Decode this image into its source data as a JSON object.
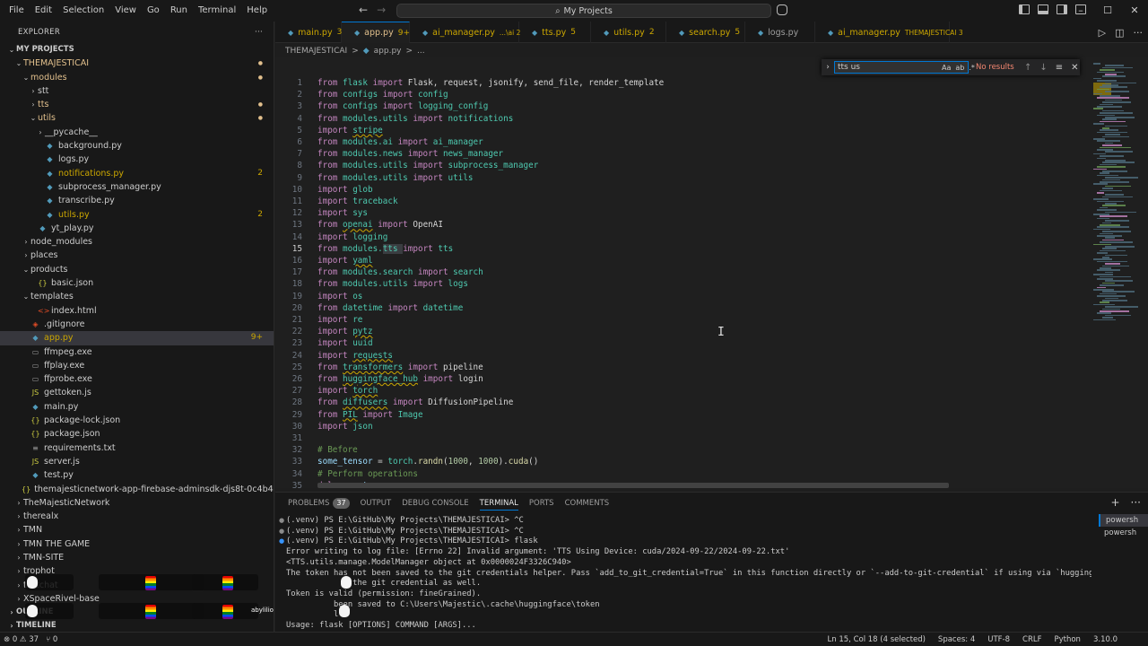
{
  "menu": [
    "File",
    "Edit",
    "Selection",
    "View",
    "Go",
    "Run",
    "Terminal",
    "Help"
  ],
  "command_center": {
    "label": "My Projects"
  },
  "window_controls": {
    "minimize": "–",
    "maximize": "☐",
    "close": "✕"
  },
  "explorer": {
    "title": "EXPLORER",
    "more": "···",
    "root": "MY PROJECTS",
    "rows": [
      {
        "label": "THEMAJESTICAI",
        "indent": 1,
        "kind": "folder-open",
        "color": "mod",
        "badge": "●"
      },
      {
        "label": "modules",
        "indent": 2,
        "kind": "folder-open",
        "color": "mod",
        "badge": "●"
      },
      {
        "label": "stt",
        "indent": 3,
        "kind": "folder",
        "color": "def",
        "badge": ""
      },
      {
        "label": "tts",
        "indent": 3,
        "kind": "folder",
        "color": "mod",
        "badge": "●"
      },
      {
        "label": "utils",
        "indent": 3,
        "kind": "folder-open",
        "color": "mod",
        "badge": "●"
      },
      {
        "label": "__pycache__",
        "indent": 4,
        "kind": "folder",
        "color": "def",
        "badge": ""
      },
      {
        "label": "background.py",
        "indent": 4,
        "kind": "py",
        "color": "def",
        "badge": ""
      },
      {
        "label": "logs.py",
        "indent": 4,
        "kind": "py",
        "color": "def",
        "badge": ""
      },
      {
        "label": "notifications.py",
        "indent": 4,
        "kind": "py",
        "color": "err",
        "badge": "2"
      },
      {
        "label": "subprocess_manager.py",
        "indent": 4,
        "kind": "py",
        "color": "def",
        "badge": ""
      },
      {
        "label": "transcribe.py",
        "indent": 4,
        "kind": "py",
        "color": "def",
        "badge": ""
      },
      {
        "label": "utils.py",
        "indent": 4,
        "kind": "py",
        "color": "err",
        "badge": "2"
      },
      {
        "label": "yt_play.py",
        "indent": 3,
        "kind": "py",
        "color": "def",
        "badge": ""
      },
      {
        "label": "node_modules",
        "indent": 2,
        "kind": "folder",
        "color": "def",
        "badge": ""
      },
      {
        "label": "places",
        "indent": 2,
        "kind": "folder",
        "color": "def",
        "badge": ""
      },
      {
        "label": "products",
        "indent": 2,
        "kind": "folder-open",
        "color": "def",
        "badge": ""
      },
      {
        "label": "basic.json",
        "indent": 3,
        "kind": "json",
        "color": "def",
        "badge": ""
      },
      {
        "label": "templates",
        "indent": 2,
        "kind": "folder-open",
        "color": "def",
        "badge": ""
      },
      {
        "label": "index.html",
        "indent": 3,
        "kind": "html",
        "color": "def",
        "badge": ""
      },
      {
        "label": ".gitignore",
        "indent": 2,
        "kind": "git",
        "color": "def",
        "badge": ""
      },
      {
        "label": "app.py",
        "indent": 2,
        "kind": "py",
        "color": "err",
        "badge": "9+",
        "selected": true
      },
      {
        "label": "ffmpeg.exe",
        "indent": 2,
        "kind": "exe",
        "color": "def",
        "badge": ""
      },
      {
        "label": "ffplay.exe",
        "indent": 2,
        "kind": "exe",
        "color": "def",
        "badge": ""
      },
      {
        "label": "ffprobe.exe",
        "indent": 2,
        "kind": "exe",
        "color": "def",
        "badge": ""
      },
      {
        "label": "gettoken.js",
        "indent": 2,
        "kind": "js",
        "color": "def",
        "badge": ""
      },
      {
        "label": "main.py",
        "indent": 2,
        "kind": "py",
        "color": "def",
        "badge": ""
      },
      {
        "label": "package-lock.json",
        "indent": 2,
        "kind": "json",
        "color": "def",
        "badge": ""
      },
      {
        "label": "package.json",
        "indent": 2,
        "kind": "json",
        "color": "def",
        "badge": ""
      },
      {
        "label": "requirements.txt",
        "indent": 2,
        "kind": "txt",
        "color": "def",
        "badge": ""
      },
      {
        "label": "server.js",
        "indent": 2,
        "kind": "js",
        "color": "def",
        "badge": ""
      },
      {
        "label": "test.py",
        "indent": 2,
        "kind": "py",
        "color": "def",
        "badge": ""
      },
      {
        "label": "themajesticnetwork-app-firebase-adminsdk-djs8t-0c4b43e23d.json",
        "indent": 2,
        "kind": "json",
        "color": "def",
        "badge": ""
      },
      {
        "label": "TheMajesticNetwork",
        "indent": 1,
        "kind": "folder",
        "color": "def",
        "badge": ""
      },
      {
        "label": "therealx",
        "indent": 1,
        "kind": "folder",
        "color": "def",
        "badge": ""
      },
      {
        "label": "TMN",
        "indent": 1,
        "kind": "folder",
        "color": "def",
        "badge": ""
      },
      {
        "label": "TMN THE GAME",
        "indent": 1,
        "kind": "folder",
        "color": "def",
        "badge": ""
      },
      {
        "label": "TMN-SITE",
        "indent": 1,
        "kind": "folder",
        "color": "def",
        "badge": ""
      },
      {
        "label": "trophot",
        "indent": 1,
        "kind": "folder",
        "color": "def",
        "badge": ""
      },
      {
        "label": "twitchat",
        "indent": 1,
        "kind": "folder",
        "color": "def",
        "badge": ""
      },
      {
        "label": "XSpaceRivel-base",
        "indent": 1,
        "kind": "folder",
        "color": "def",
        "badge": ""
      },
      {
        "label": "OUTLINE",
        "indent": 0,
        "kind": "section",
        "color": "def",
        "badge": ""
      },
      {
        "label": "TIMELINE",
        "indent": 0,
        "kind": "section",
        "color": "def",
        "badge": ""
      }
    ]
  },
  "tabs": [
    {
      "name": "main.py",
      "badge": "3",
      "active": false,
      "width": 74
    },
    {
      "name": "app.py",
      "badge": "9+",
      "active": true,
      "width": 76
    },
    {
      "name": "ai_manager.py",
      "badge": "...\\ai 2",
      "active": false,
      "width": 122
    },
    {
      "name": "tts.py",
      "badge": "5",
      "active": false,
      "width": 80
    },
    {
      "name": "utils.py",
      "badge": "2",
      "active": false,
      "width": 84
    },
    {
      "name": "search.py",
      "badge": "5",
      "active": false,
      "width": 88
    },
    {
      "name": "logs.py",
      "badge": "",
      "active": false,
      "width": 78
    },
    {
      "name": "ai_manager.py",
      "badge": "THEMAJESTICAI 3",
      "active": false,
      "width": 150
    }
  ],
  "breadcrumb": {
    "folder": "THEMAJESTICAI",
    "sep": ">",
    "file": "app.py",
    "tail": "..."
  },
  "find": {
    "query": "tts us",
    "result": "No results",
    "opt_case": "Aa",
    "opt_word": "ab",
    "opt_regex": ".*"
  },
  "code": [
    [
      [
        "kw",
        "from "
      ],
      [
        "mod",
        "flask"
      ],
      [
        "kw",
        " import "
      ],
      [
        "pl",
        "Flask, request, jsonify, send_file, render_template"
      ]
    ],
    [
      [
        "kw",
        "from "
      ],
      [
        "mod",
        "configs"
      ],
      [
        "kw",
        " import "
      ],
      [
        "mod",
        "config"
      ]
    ],
    [
      [
        "kw",
        "from "
      ],
      [
        "mod",
        "configs"
      ],
      [
        "kw",
        " import "
      ],
      [
        "mod",
        "logging_config"
      ]
    ],
    [
      [
        "kw",
        "from "
      ],
      [
        "mod",
        "modules.utils"
      ],
      [
        "kw",
        " import "
      ],
      [
        "mod",
        "notifications"
      ]
    ],
    [
      [
        "kw",
        "import "
      ],
      [
        "mod sq",
        "stripe"
      ]
    ],
    [
      [
        "kw",
        "from "
      ],
      [
        "mod",
        "modules.ai"
      ],
      [
        "kw",
        " import "
      ],
      [
        "mod",
        "ai_manager"
      ]
    ],
    [
      [
        "kw",
        "from "
      ],
      [
        "mod",
        "modules.news"
      ],
      [
        "kw",
        " import "
      ],
      [
        "mod",
        "news_manager"
      ]
    ],
    [
      [
        "kw",
        "from "
      ],
      [
        "mod",
        "modules.utils"
      ],
      [
        "kw",
        " import "
      ],
      [
        "mod",
        "subprocess_manager"
      ]
    ],
    [
      [
        "kw",
        "from "
      ],
      [
        "mod",
        "modules.utils"
      ],
      [
        "kw",
        " import "
      ],
      [
        "mod",
        "utils"
      ]
    ],
    [
      [
        "kw",
        "import "
      ],
      [
        "mod",
        "glob"
      ]
    ],
    [
      [
        "kw",
        "import "
      ],
      [
        "mod",
        "traceback"
      ]
    ],
    [
      [
        "kw",
        "import "
      ],
      [
        "mod",
        "sys"
      ]
    ],
    [
      [
        "kw",
        "from "
      ],
      [
        "mod sq",
        "openai"
      ],
      [
        "kw",
        " import "
      ],
      [
        "pl",
        "OpenAI"
      ]
    ],
    [
      [
        "kw",
        "import "
      ],
      [
        "mod",
        "logging"
      ]
    ],
    [
      [
        "kw",
        "from "
      ],
      [
        "mod",
        "modules."
      ],
      [
        "mod hl",
        "tts"
      ],
      [
        "kw hl",
        " "
      ],
      [
        "kw",
        "import "
      ],
      [
        "mod",
        "tts"
      ]
    ],
    [
      [
        "kw",
        "import "
      ],
      [
        "mod sq",
        "yaml"
      ]
    ],
    [
      [
        "kw",
        "from "
      ],
      [
        "mod",
        "modules.search"
      ],
      [
        "kw",
        " import "
      ],
      [
        "mod",
        "search"
      ]
    ],
    [
      [
        "kw",
        "from "
      ],
      [
        "mod",
        "modules.utils"
      ],
      [
        "kw",
        " import "
      ],
      [
        "mod",
        "logs"
      ]
    ],
    [
      [
        "kw",
        "import "
      ],
      [
        "mod",
        "os"
      ]
    ],
    [
      [
        "kw",
        "from "
      ],
      [
        "mod",
        "datetime"
      ],
      [
        "kw",
        " import "
      ],
      [
        "mod",
        "datetime"
      ]
    ],
    [
      [
        "kw",
        "import "
      ],
      [
        "mod",
        "re"
      ]
    ],
    [
      [
        "kw",
        "import "
      ],
      [
        "mod sq",
        "pytz"
      ]
    ],
    [
      [
        "kw",
        "import "
      ],
      [
        "mod",
        "uuid"
      ]
    ],
    [
      [
        "kw",
        "import "
      ],
      [
        "mod sq",
        "requests"
      ]
    ],
    [
      [
        "kw",
        "from "
      ],
      [
        "mod sq",
        "transformers"
      ],
      [
        "kw",
        " import "
      ],
      [
        "pl",
        "pipeline"
      ]
    ],
    [
      [
        "kw",
        "from "
      ],
      [
        "mod sq",
        "huggingface_hub"
      ],
      [
        "kw",
        " import "
      ],
      [
        "pl",
        "login"
      ]
    ],
    [
      [
        "kw",
        "import "
      ],
      [
        "mod sq",
        "torch"
      ]
    ],
    [
      [
        "kw",
        "from "
      ],
      [
        "mod sq",
        "diffusers"
      ],
      [
        "kw",
        " import "
      ],
      [
        "pl",
        "DiffusionPipeline"
      ]
    ],
    [
      [
        "kw",
        "from "
      ],
      [
        "mod sq",
        "PIL"
      ],
      [
        "kw",
        " import "
      ],
      [
        "mod",
        "Image"
      ]
    ],
    [
      [
        "kw",
        "import "
      ],
      [
        "mod",
        "json"
      ]
    ],
    [],
    [
      [
        "cm",
        "# Before"
      ]
    ],
    [
      [
        "id",
        "some_tensor"
      ],
      [
        "pl",
        " = "
      ],
      [
        "mod",
        "torch"
      ],
      [
        "pl",
        "."
      ],
      [
        "fn",
        "randn"
      ],
      [
        "pl",
        "("
      ],
      [
        "num",
        "1000"
      ],
      [
        "pl",
        ", "
      ],
      [
        "num",
        "1000"
      ],
      [
        "pl",
        ")."
      ],
      [
        "fn",
        "cuda"
      ],
      [
        "pl",
        "()"
      ]
    ],
    [
      [
        "cm",
        "# Perform operations"
      ]
    ],
    [
      [
        "kw",
        "del "
      ],
      [
        "id",
        "some_tensor"
      ]
    ]
  ],
  "current_line": 15,
  "panel": {
    "tabs": [
      "PROBLEMS",
      "OUTPUT",
      "DEBUG CONSOLE",
      "TERMINAL",
      "PORTS",
      "COMMENTS"
    ],
    "problems_count": "37",
    "active_tab": "TERMINAL",
    "terminals": [
      "powersh",
      "powersh"
    ],
    "lines": [
      {
        "dot": "grey",
        "text": "(.venv) PS E:\\GitHub\\My Projects\\THEMAJESTICAI> ^C"
      },
      {
        "dot": "grey",
        "text": "(.venv) PS E:\\GitHub\\My Projects\\THEMAJESTICAI> ^C"
      },
      {
        "dot": "blue",
        "text": "(.venv) PS E:\\GitHub\\My Projects\\THEMAJESTICAI> flask"
      },
      {
        "dot": "",
        "text": "Error writing to log file: [Errno 22] Invalid argument: 'TTS Using Device: cuda/2024-09-22/2024-09-22.txt'"
      },
      {
        "dot": "",
        "text": "<TTS.utils.manage.ModelManager object at 0x0000024F3326C940>"
      },
      {
        "dot": "",
        "text": "The token has not been saved to the git credentials helper. Pass `add_to_git_credential=True` in this function directly or `--add-to-git-credential` if using via `huggingface-cli` if"
      },
      {
        "dot": "",
        "text": "              the git credential as well."
      },
      {
        "dot": "",
        "text": "Token is valid (permission: fineGrained)."
      },
      {
        "dot": "",
        "text": "          been saved to C:\\Users\\Majestic\\.cache\\huggingface\\token"
      },
      {
        "dot": "",
        "text": "          l"
      },
      {
        "dot": "",
        "text": "Usage: flask [OPTIONS] COMMAND [ARGS]..."
      }
    ]
  },
  "overlay": {
    "name": "abylilio"
  },
  "status": {
    "left_errors": "⊗ 0 ⚠ 37",
    "left_ports": "⑂ 0",
    "position": "Ln 15, Col 18 (4 selected)",
    "spaces": "Spaces: 4",
    "encoding": "UTF-8",
    "eol": "CRLF",
    "language": "Python",
    "version": "3.10.0"
  },
  "colors": {
    "accent": "#0078d4",
    "modified": "#e2c08d",
    "warning": "#cca700"
  }
}
